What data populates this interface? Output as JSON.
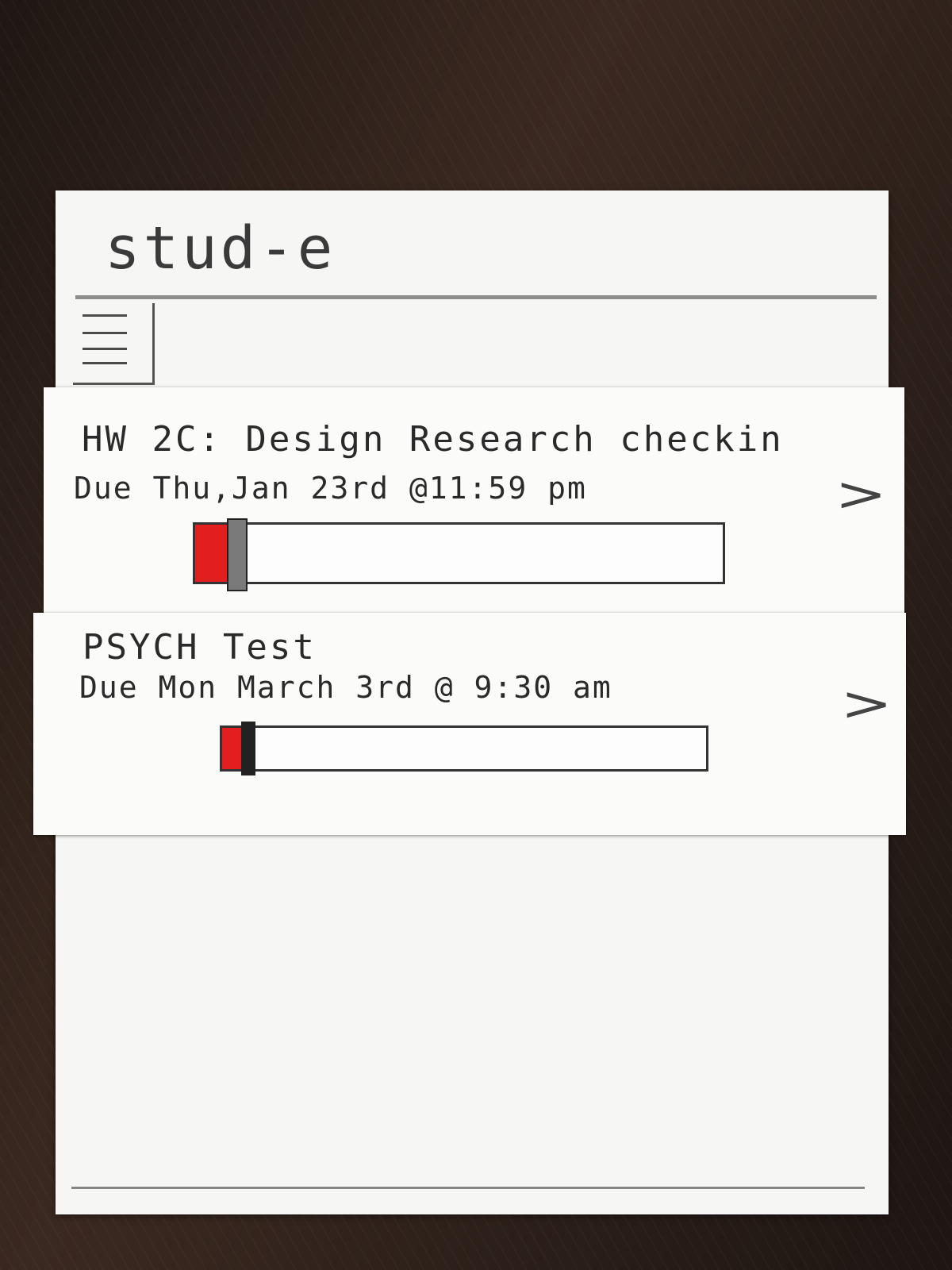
{
  "app": {
    "title": "stud-e"
  },
  "menu": {
    "icon": "hamburger-icon"
  },
  "tasks": [
    {
      "title": "HW 2C: Design Research checkin",
      "due": "Due Thu,Jan 23rd @11:59 pm",
      "progress": 0.06,
      "open_icon": "chevron-right-icon"
    },
    {
      "title": "PSYCH Test",
      "due": "Due Mon March 3rd @ 9:30 am",
      "progress": 0.04,
      "open_icon": "chevron-right-icon"
    }
  ],
  "colors": {
    "progress_fill": "#e31e1e",
    "paper": "#f6f6f4"
  }
}
